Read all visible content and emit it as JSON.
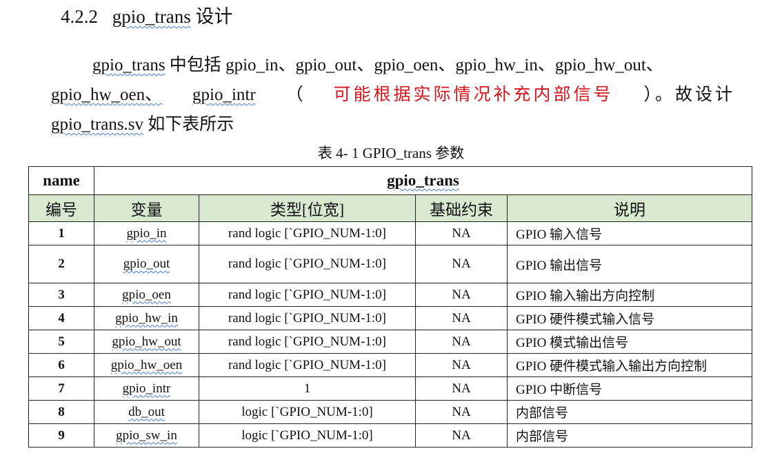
{
  "section": {
    "number": "4.2.2",
    "title_name": "gpio_trans",
    "title_suffix": "设计"
  },
  "paragraph": {
    "l1_a": "gpio_trans",
    "l1_b": " 中包括 ",
    "l1_c": "gpio_in、gpio_out、gpio_oen、gpio_hw_in、gpio_hw_out、",
    "l2_a": "gpio_hw_oen、",
    "l2_b": "gpio_intr",
    "l2_c": "（",
    "l2_red": "可能根据实际情况补充内部信号",
    "l2_d": "）。故设计",
    "l3_a": "gpio_trans.sv",
    "l3_b": " 如下表所示"
  },
  "caption": "表  4- 1 GPIO_trans 参数",
  "table": {
    "name_header": "name",
    "title_header": "gpio_trans",
    "columns": [
      "编号",
      "变量",
      "类型[位宽]",
      "基础约束",
      "说明"
    ],
    "rows": [
      {
        "idx": "1",
        "var": "gpio_in",
        "type": "rand logic [`GPIO_NUM-1:0]",
        "cons": "NA",
        "desc": "GPIO 输入信号"
      },
      {
        "idx": "2",
        "var": "gpio_out",
        "type": "rand logic [`GPIO_NUM-1:0]",
        "cons": "NA",
        "desc": "GPIO 输出信号"
      },
      {
        "idx": "3",
        "var": "gpio_oen",
        "type": "rand logic [`GPIO_NUM-1:0]",
        "cons": "NA",
        "desc": "GPIO 输入输出方向控制"
      },
      {
        "idx": "4",
        "var": "gpio_hw_in",
        "type": "rand logic [`GPIO_NUM-1:0]",
        "cons": "NA",
        "desc": "GPIO 硬件模式输入信号"
      },
      {
        "idx": "5",
        "var": "gpio_hw_out",
        "type": "rand logic [`GPIO_NUM-1:0]",
        "cons": "NA",
        "desc": "GPIO  模式输出信号"
      },
      {
        "idx": "6",
        "var": "gpio_hw_oen",
        "type": "rand logic [`GPIO_NUM-1:0]",
        "cons": "NA",
        "desc": "GPIO 硬件模式输入输出方向控制"
      },
      {
        "idx": "7",
        "var": "gpio_intr",
        "type": "1",
        "cons": "NA",
        "desc": "GPIO 中断信号"
      },
      {
        "idx": "8",
        "var": "db_out",
        "type": "logic [`GPIO_NUM-1:0]",
        "cons": "NA",
        "desc": "内部信号"
      },
      {
        "idx": "9",
        "var": "gpio_sw_in",
        "type": "logic [`GPIO_NUM-1:0]",
        "cons": "NA",
        "desc": "内部信号"
      }
    ]
  }
}
